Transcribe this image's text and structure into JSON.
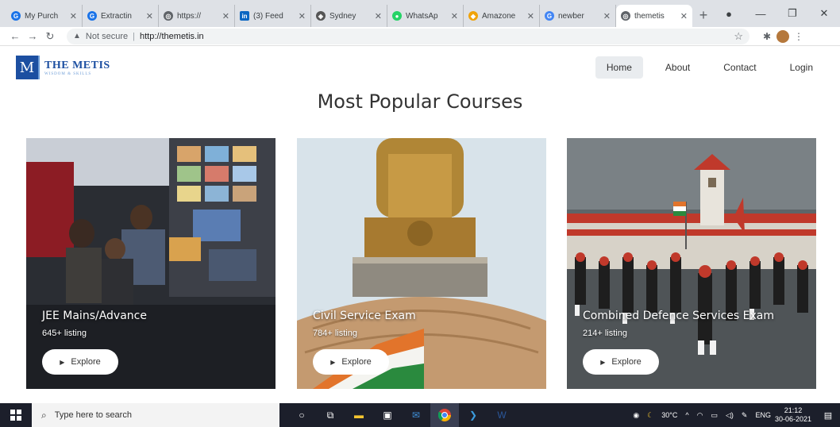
{
  "browser": {
    "tabs": [
      {
        "title": "My Purch",
        "color": "#1a73e8",
        "glyph": "G"
      },
      {
        "title": "Extractin",
        "color": "#1a73e8",
        "glyph": "G"
      },
      {
        "title": "https://",
        "color": "#5f6368",
        "glyph": "◎"
      },
      {
        "title": "(3) Feed",
        "color": "#0a66c2",
        "glyph": "in"
      },
      {
        "title": "Sydney",
        "color": "#555555",
        "glyph": "◈"
      },
      {
        "title": "WhatsAp",
        "color": "#25d366",
        "glyph": "●"
      },
      {
        "title": "Amazone",
        "color": "#f0a30a",
        "glyph": "◆"
      },
      {
        "title": "newber",
        "color": "#4285f4",
        "glyph": "G"
      },
      {
        "title": "themetis",
        "color": "#5f6368",
        "glyph": "◎"
      }
    ],
    "new_tab": "+",
    "security": "Not secure",
    "url": "http://themetis.in"
  },
  "site": {
    "logo_letter": "M",
    "logo_name": "THE METIS",
    "logo_tag": "WISDOM & SKILLS",
    "nav": [
      "Home",
      "About",
      "Contact",
      "Login"
    ],
    "heading": "Most Popular Courses"
  },
  "courses": [
    {
      "title": "JEE Mains/Advance",
      "listing": "645+ listing",
      "button": "Explore"
    },
    {
      "title": "Civil Service Exam",
      "listing": "784+ listing",
      "button": "Explore"
    },
    {
      "title": "Combined Defence Services Exam",
      "listing": "214+ listing",
      "button": "Explore"
    }
  ],
  "taskbar": {
    "search_placeholder": "Type here to search",
    "weather": "30°C",
    "lang": "ENG",
    "time": "21:12",
    "date": "30-06-2021"
  }
}
